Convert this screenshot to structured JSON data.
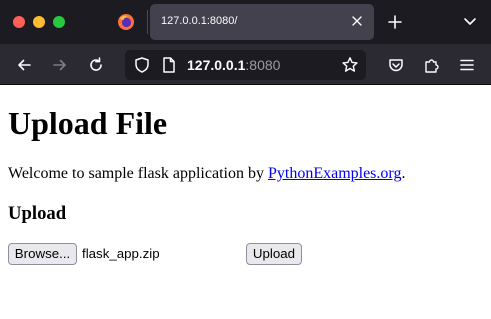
{
  "browser": {
    "tab_title": "127.0.0.1:8080/",
    "url_host": "127.0.0.1",
    "url_port": ":8080",
    "icons": [
      "close-window",
      "minimize-window",
      "zoom-window",
      "firefox-logo",
      "tab-close",
      "new-tab",
      "list-tabs",
      "back-arrow",
      "forward-arrow",
      "reload",
      "shield",
      "page",
      "bookmark-star",
      "pocket",
      "extensions",
      "menu"
    ]
  },
  "page": {
    "title": "Upload File",
    "welcome_prefix": "Welcome to sample flask application by ",
    "welcome_link": "PythonExamples.org",
    "welcome_suffix": ".",
    "section_title": "Upload",
    "browse_label": "Browse...",
    "file_name": "flask_app.zip",
    "upload_label": "Upload",
    "link_color": "#0000ee"
  }
}
